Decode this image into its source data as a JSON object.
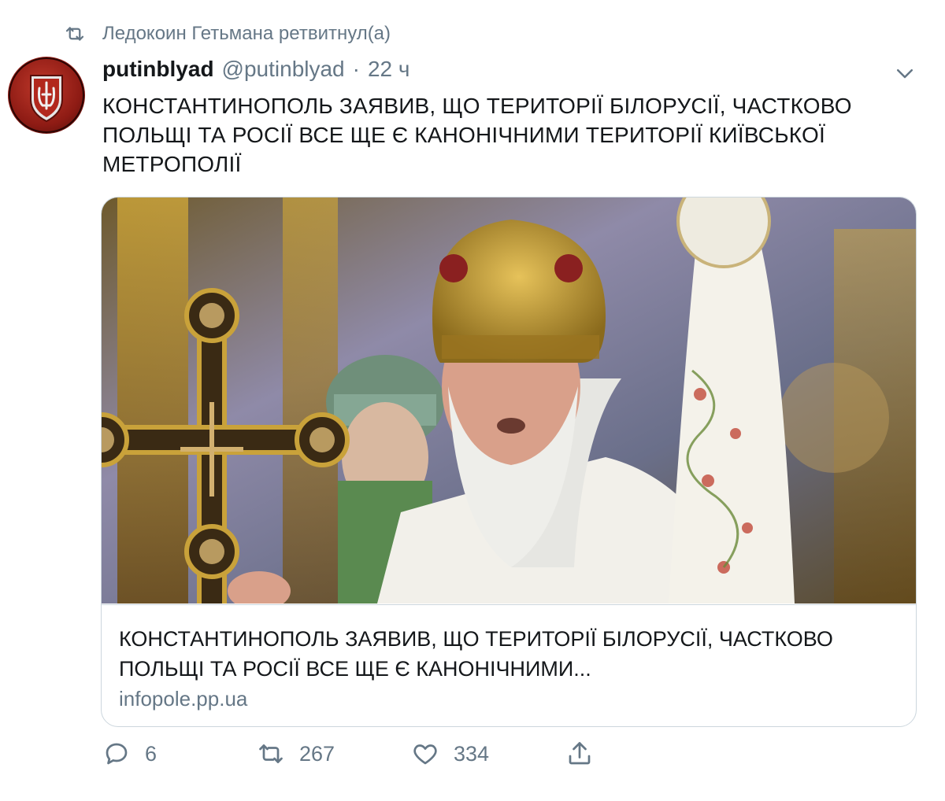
{
  "retweet_context": {
    "text": "Ледокоин Гетьмана ретвитнул(а)"
  },
  "author": {
    "display_name": "putinblyad",
    "handle": "@putinblyad",
    "separator": "·",
    "time": "22 ч"
  },
  "tweet": {
    "text": "КОНСТАНТИНОПОЛЬ ЗАЯВИВ, ЩО ТЕРИТОРІЇ БІЛОРУСІЇ, ЧАСТКОВО ПОЛЬЩІ ТА РОСІЇ ВСЕ ЩЕ Є КАНОНІЧНИМИ ТЕРИТОРІЇ КИЇВСЬКОЇ МЕТРОПОЛІЇ"
  },
  "link_card": {
    "title": "КОНСТАНТИНОПОЛЬ ЗАЯВИВ, ЩО ТЕРИТОРІЇ БІЛОРУСІЇ, ЧАСТКОВО ПОЛЬЩІ ТА РОСІЇ ВСЕ ЩЕ Є КАНОНІЧНИМИ...",
    "domain": "infopole.pp.ua"
  },
  "actions": {
    "replies": "6",
    "retweets": "267",
    "likes": "334"
  },
  "icons": [
    "retweet-icon",
    "chevron-down-icon",
    "reply-icon",
    "like-icon",
    "share-icon"
  ],
  "colors": {
    "text": "#14171a",
    "secondary": "#657786",
    "border": "#ccd6dd"
  }
}
